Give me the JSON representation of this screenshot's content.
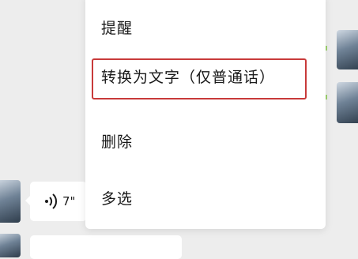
{
  "context_menu": {
    "items": [
      {
        "label": "提醒"
      },
      {
        "label": "转换为文字（仅普通话）",
        "highlighted": true
      },
      {
        "label": "删除"
      },
      {
        "label": "多选"
      }
    ]
  },
  "voice_message": {
    "duration": "7\"",
    "icon": "voice-wave-icon"
  },
  "colors": {
    "highlight_border": "#c83a3a",
    "chat_background": "#ededed",
    "menu_background": "#ffffff"
  }
}
